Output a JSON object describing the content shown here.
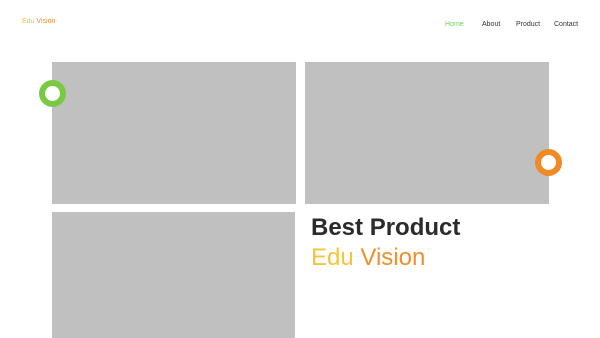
{
  "brand": {
    "logo_edu": "Edu",
    "logo_vision": "Vision"
  },
  "nav": {
    "items": [
      {
        "label": "Home",
        "active": true
      },
      {
        "label": "About",
        "active": false
      },
      {
        "label": "Product",
        "active": false
      },
      {
        "label": "Contact",
        "active": false
      }
    ]
  },
  "hero": {
    "title": "Best Product",
    "subtitle_edu": "Edu",
    "subtitle_vision": "Vision"
  },
  "colors": {
    "accent_green": "#7ac943",
    "accent_orange": "#ef8a25",
    "accent_yellow": "#f2c53d",
    "placeholder_gray": "#c0c0c0",
    "text_dark": "#2b2b2b"
  }
}
